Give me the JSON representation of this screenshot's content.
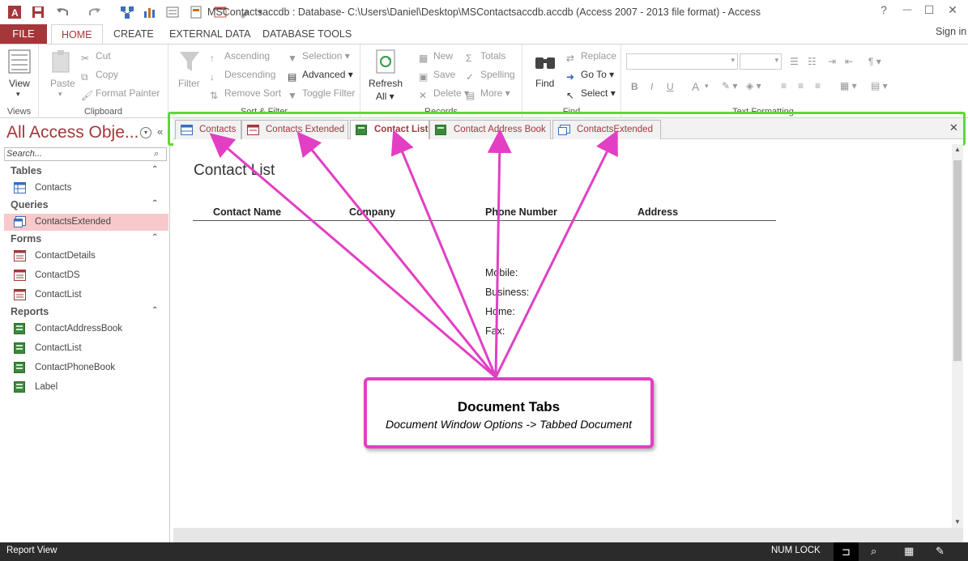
{
  "titlebar": {
    "title": "MSContactsaccdb : Database- C:\\Users\\Daniel\\Desktop\\MSContactsaccdb.accdb (Access 2007 - 2013 file format) - Access",
    "help": "?",
    "minimize": "—",
    "restore": "☐",
    "close": "✕"
  },
  "menubar": {
    "file": "FILE",
    "tabs": [
      "HOME",
      "CREATE",
      "EXTERNAL DATA",
      "DATABASE TOOLS"
    ],
    "signin": "Sign in"
  },
  "ribbon": {
    "views": {
      "view": "View",
      "label": "Views"
    },
    "clipboard": {
      "paste": "Paste",
      "cut": "Cut",
      "copy": "Copy",
      "format_painter": "Format Painter",
      "label": "Clipboard"
    },
    "sort_filter": {
      "filter": "Filter",
      "ascending": "Ascending",
      "descending": "Descending",
      "remove_sort": "Remove Sort",
      "selection": "Selection",
      "advanced": "Advanced",
      "toggle_filter": "Toggle Filter",
      "label": "Sort & Filter"
    },
    "records": {
      "refresh": "Refresh",
      "refresh_all": "All",
      "new": "New",
      "save": "Save",
      "delete": "Delete",
      "totals": "Totals",
      "spelling": "Spelling",
      "more": "More",
      "label": "Records"
    },
    "find": {
      "find": "Find",
      "replace": "Replace",
      "goto": "Go To",
      "select": "Select",
      "label": "Find"
    },
    "text_formatting": {
      "label": "Text Formatting",
      "bold": "B",
      "italic": "I",
      "underline": "U",
      "font_color": "A"
    }
  },
  "navpane": {
    "title": "All Access Obje...",
    "search_placeholder": "Search...",
    "groups": [
      {
        "name": "Tables",
        "items": [
          "Contacts"
        ]
      },
      {
        "name": "Queries",
        "items": [
          "ContactsExtended"
        ]
      },
      {
        "name": "Forms",
        "items": [
          "ContactDetails",
          "ContactDS",
          "ContactList"
        ]
      },
      {
        "name": "Reports",
        "items": [
          "ContactAddressBook",
          "ContactList",
          "ContactPhoneBook",
          "Label"
        ]
      }
    ]
  },
  "doctabs": [
    {
      "label": "Contacts",
      "type": "table"
    },
    {
      "label": "Contacts Extended",
      "type": "form"
    },
    {
      "label": "Contact List",
      "type": "report",
      "active": true
    },
    {
      "label": "Contact Address Book",
      "type": "report"
    },
    {
      "label": "ContactsExtended",
      "type": "query"
    }
  ],
  "report": {
    "title": "Contact List",
    "headers": [
      "Contact Name",
      "Company",
      "Phone Number",
      "Address"
    ],
    "phone_labels": [
      "Mobile:",
      "Business:",
      "Home:",
      "Fax:"
    ]
  },
  "callout": {
    "title": "Document Tabs",
    "subtitle": "Document Window Options -> Tabbed Document"
  },
  "statusbar": {
    "left": "Report View",
    "numlock": "NUM LOCK"
  },
  "colors": {
    "access_red": "#a4373a",
    "highlight_green": "#5fd932",
    "annotation_pink": "#e23fc4",
    "nav_selected": "#f7c9cb",
    "statusbar": "#2b2b2b"
  }
}
